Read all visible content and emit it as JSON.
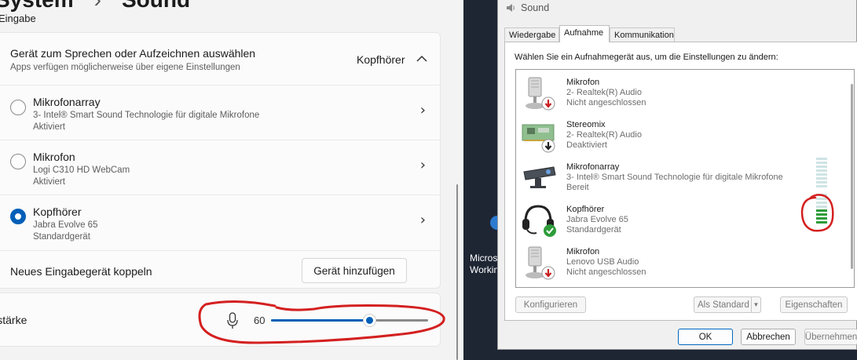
{
  "settings": {
    "breadcrumb": {
      "parent": "System",
      "current": "Sound"
    },
    "section": "Eingabe",
    "select_device": {
      "title": "Gerät zum Sprechen oder Aufzeichnen auswählen",
      "subtitle": "Apps verfügen möglicherweise über eigene Einstellungen",
      "current": "Kopfhörer"
    },
    "devices": [
      {
        "name": "Mikrofonarray",
        "desc": "3- Intel® Smart Sound Technologie für digitale Mikrofone",
        "status": "Aktiviert",
        "selected": false
      },
      {
        "name": "Mikrofon",
        "desc": "Logi C310 HD WebCam",
        "status": "Aktiviert",
        "selected": false
      },
      {
        "name": "Kopfhörer",
        "desc": "Jabra Evolve 65",
        "status": "Standardgerät",
        "selected": true
      }
    ],
    "pair": {
      "label": "Neues Eingabegerät koppeln",
      "button": "Gerät hinzufügen"
    },
    "volume": {
      "label": "Lautstärke",
      "value": "60",
      "level": 60
    },
    "accent": "#005fb8"
  },
  "desktop": {
    "icon_label_1": "Microsoft",
    "icon_label_2": "Working"
  },
  "dialog": {
    "title": "Sound",
    "tabs": [
      "Wiedergabe",
      "Aufnahme",
      "Kommunikation"
    ],
    "active_tab": "Aufnahme",
    "instruction": "Wählen Sie ein Aufnahmegerät aus, um die Einstellungen zu ändern:",
    "devices": [
      {
        "name": "Mikrofon",
        "line2": "2- Realtek(R) Audio",
        "status": "Nicht angeschlossen",
        "icon": "microphone-icon",
        "badge": "disconnected-badge-icon"
      },
      {
        "name": "Stereomix",
        "line2": "2- Realtek(R) Audio",
        "status": "Deaktiviert",
        "icon": "sound-card-icon",
        "badge": "disabled-badge-icon"
      },
      {
        "name": "Mikrofonarray",
        "line2": "3- Intel® Smart Sound Technologie für digitale Mikrofone",
        "status": "Bereit",
        "icon": "mic-array-icon",
        "badge": ""
      },
      {
        "name": "Kopfhörer",
        "line2": "Jabra Evolve 65",
        "status": "Standardgerät",
        "icon": "headset-icon",
        "badge": "default-check-icon"
      },
      {
        "name": "Mikrofon",
        "line2": "Lenovo USB Audio",
        "status": "Nicht angeschlossen",
        "icon": "microphone-icon",
        "badge": "disconnected-badge-icon"
      }
    ],
    "buttons": {
      "configure": "Konfigurieren",
      "set_default": "Als Standard",
      "properties": "Eigenschaften",
      "ok": "OK",
      "cancel": "Abbrechen",
      "apply": "Übernehmen"
    },
    "meter_color_lit": "#2e9c3a",
    "annotation_color": "#d42020"
  }
}
